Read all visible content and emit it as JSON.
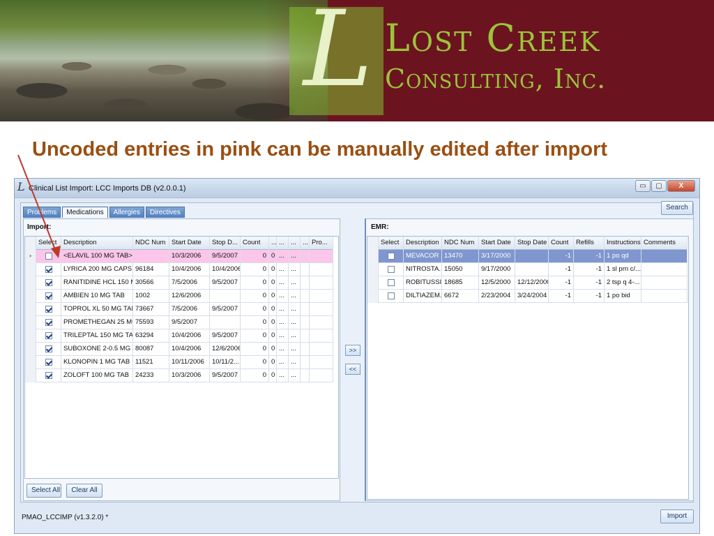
{
  "banner": {
    "brand_line1": "Lost Creek",
    "brand_line2": "Consulting, Inc.",
    "logo_letter": "L"
  },
  "slide": {
    "heading": "Uncoded entries in pink can be manually edited after import",
    "heading_color": "#9a4f12"
  },
  "window": {
    "title": "Clinical List Import: LCC Imports DB  (v2.0.0.1)",
    "app_icon": "L",
    "minimize_label": "▭",
    "maximize_label": "▢",
    "close_label": "X"
  },
  "tabs": [
    {
      "label": "Problems"
    },
    {
      "label": "Medications"
    },
    {
      "label": "Allergies"
    },
    {
      "label": "Directives"
    }
  ],
  "search_label": "Search",
  "import_panel": {
    "label": "Import:",
    "columns": [
      "Select",
      "Description",
      "NDC Num",
      "Start Date",
      "Stop D...",
      "Count",
      "...",
      "...",
      "...",
      "...",
      "Pro..."
    ],
    "rows": [
      {
        "checked": false,
        "highlight": "pink",
        "current": true,
        "cells": [
          "<ELAVIL 100 MG TAB>",
          "",
          "10/3/2006",
          "9/5/2007",
          "0",
          "0",
          "...",
          "...",
          "",
          ""
        ]
      },
      {
        "checked": true,
        "cells": [
          "LYRICA 200 MG CAPS",
          "96184",
          "10/4/2006",
          "10/4/2006",
          "0",
          "0",
          "...",
          "...",
          "",
          ""
        ]
      },
      {
        "checked": true,
        "cells": [
          "RANITIDINE HCL 150 M...",
          "30566",
          "7/5/2006",
          "9/5/2007",
          "0",
          "0",
          "...",
          "...",
          "",
          ""
        ]
      },
      {
        "checked": true,
        "cells": [
          "AMBIEN 10 MG TAB",
          "1002",
          "12/6/2006",
          "",
          "0",
          "0",
          "...",
          "...",
          "",
          ""
        ]
      },
      {
        "checked": true,
        "cells": [
          "TOPROL XL 50 MG TABS...",
          "73667",
          "7/5/2006",
          "9/5/2007",
          "0",
          "0",
          "...",
          "...",
          "",
          ""
        ]
      },
      {
        "checked": true,
        "cells": [
          "PROMETHEGAN 25 MG ...",
          "75593",
          "9/5/2007",
          "",
          "0",
          "0",
          "...",
          "...",
          "",
          ""
        ]
      },
      {
        "checked": true,
        "cells": [
          "TRILEPTAL 150 MG TABS",
          "63294",
          "10/4/2006",
          "9/5/2007",
          "0",
          "0",
          "...",
          "...",
          "",
          ""
        ]
      },
      {
        "checked": true,
        "cells": [
          "SUBOXONE 2-0.5 MG SUBL",
          "80087",
          "10/4/2006",
          "12/6/2006",
          "0",
          "0",
          "...",
          "...",
          "",
          ""
        ]
      },
      {
        "checked": true,
        "cells": [
          "KLONOPIN 1 MG TAB",
          "11521",
          "10/11/2006",
          "10/11/2...",
          "0",
          "0",
          "...",
          "...",
          "",
          ""
        ]
      },
      {
        "checked": true,
        "cells": [
          "ZOLOFT 100 MG TAB",
          "24233",
          "10/3/2006",
          "9/5/2007",
          "0",
          "0",
          "...",
          "...",
          "",
          ""
        ]
      }
    ],
    "select_all_label": "Select All",
    "clear_all_label": "Clear All"
  },
  "transfer": {
    "right_label": ">>",
    "left_label": "<<"
  },
  "emr_panel": {
    "label": "EMR:",
    "columns": [
      "Select",
      "Description",
      "NDC Num",
      "Start Date",
      "Stop Date",
      "Count",
      "Refills",
      "Instructions",
      "Comments"
    ],
    "rows": [
      {
        "checked": false,
        "selected": true,
        "current": true,
        "cells": [
          "MEVACOR ...",
          "13470",
          "3/17/2000",
          "",
          "-1",
          "-1",
          "1 po qd",
          ""
        ]
      },
      {
        "checked": false,
        "cells": [
          "NITROSTA...",
          "15050",
          "9/17/2000",
          "",
          "-1",
          "-1",
          "1 sl prn c/...",
          ""
        ]
      },
      {
        "checked": false,
        "cells": [
          "ROBITUSSI...",
          "18685",
          "12/5/2000",
          "12/12/2000",
          "-1",
          "-1",
          "2 tsp q 4-...",
          ""
        ]
      },
      {
        "checked": false,
        "cells": [
          "DILTIAZEM...",
          "6672",
          "2/23/2004",
          "3/24/2004",
          "-1",
          "-1",
          "1 po bid",
          ""
        ]
      }
    ]
  },
  "status": {
    "version": "PMAO_LCCIMP (v1.3.2.0) *"
  },
  "import_label": "Import",
  "colors": {
    "uncoded_row": "#fbc6ea",
    "selected_row": "#7f96cf",
    "callout_arrow": "#c0392b"
  }
}
